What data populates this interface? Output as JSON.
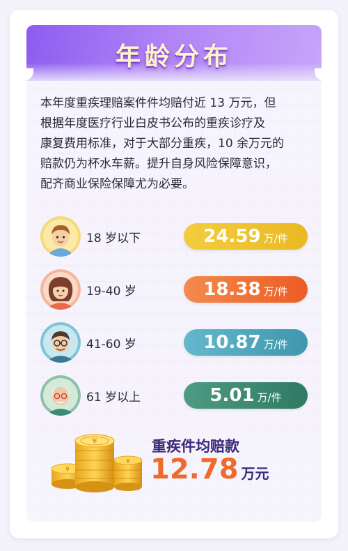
{
  "title": "年龄分布",
  "intro": {
    "lines": [
      "本年度重疾理赔案件件均赔付近 13 万元，但",
      "根据年度医疗行业白皮书公布的重疾诊疗及",
      "康复费用标准，对于大部分重疾，10 余万元的",
      "赔款仍为杯水车薪。提升自身风险保障意识，",
      "配齐商业保险保障尤为必要。"
    ]
  },
  "age_groups": [
    {
      "label": "18 岁以下",
      "value": "24.59",
      "unit": "万/件",
      "color": "#efc22c",
      "avatar_icon": "child-avatar-icon"
    },
    {
      "label": "19-40 岁",
      "value": "18.38",
      "unit": "万/件",
      "color": "#ef6a2c",
      "avatar_icon": "woman-avatar-icon"
    },
    {
      "label": "41-60 岁",
      "value": "10.87",
      "unit": "万/件",
      "color": "#4aa3b8",
      "avatar_icon": "man-glasses-avatar-icon"
    },
    {
      "label": "61 岁以上",
      "value": "5.01",
      "unit": "万/件",
      "color": "#3e8a74",
      "avatar_icon": "elder-avatar-icon"
    }
  ],
  "summary": {
    "label": "重疾件均赔款",
    "value": "12.78",
    "unit": "万元",
    "icon": "gold-coins-icon"
  },
  "colors": {
    "header_purple": "#8d5cf0",
    "accent_orange": "#ef6a2c",
    "text_dark": "#2a2a3a"
  }
}
